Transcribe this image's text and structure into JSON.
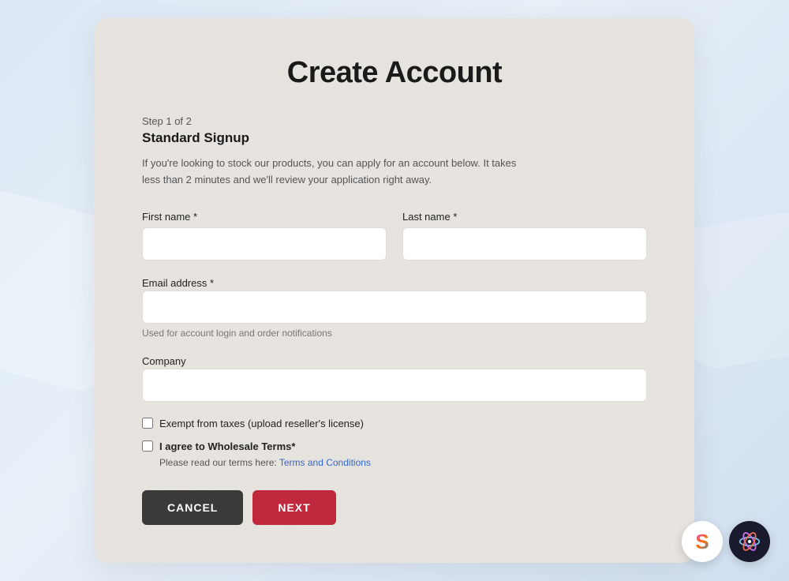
{
  "page": {
    "title": "Create Account",
    "background_color": "#dce8f5"
  },
  "card": {
    "title": "Create Account",
    "step_label": "Step 1 of 2",
    "step_heading": "Standard Signup",
    "step_description": "If you're looking to stock our products, you can apply for an account below. It takes less than 2 minutes and we'll review your application right away.",
    "fields": {
      "first_name_label": "First name *",
      "first_name_placeholder": "",
      "last_name_label": "Last name *",
      "last_name_placeholder": "",
      "email_label": "Email address *",
      "email_placeholder": "",
      "email_hint": "Used for account login and order notifications",
      "company_label": "Company",
      "company_placeholder": ""
    },
    "checkboxes": {
      "tax_exempt_label": "Exempt from taxes (upload reseller's license)",
      "terms_label": "I agree to Wholesale Terms*",
      "terms_prefix": "Please read our terms here: ",
      "terms_link_text": "Terms and Conditions",
      "terms_link_href": "#"
    },
    "buttons": {
      "cancel_label": "CANCEL",
      "next_label": "NEXT"
    }
  },
  "floating_icons": {
    "s_icon_label": "S",
    "bolt_icon_label": "bolt"
  }
}
